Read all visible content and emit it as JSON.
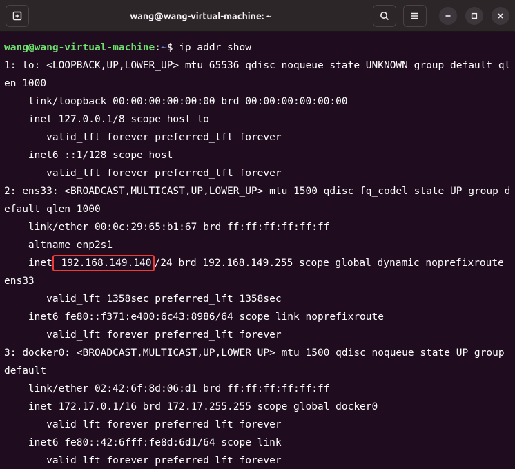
{
  "titlebar": {
    "title": "wang@wang-virtual-machine: ~"
  },
  "prompt": {
    "user_host": "wang@wang-virtual-machine",
    "colon": ":",
    "path": "~",
    "dollar": "$ "
  },
  "command": "ip addr show",
  "highlight": " 192.168.149.140",
  "output": {
    "l1": "1: lo: <LOOPBACK,UP,LOWER_UP> mtu 65536 qdisc noqueue state UNKNOWN group default qlen 1000",
    "l2": "    link/loopback 00:00:00:00:00:00 brd 00:00:00:00:00:00",
    "l3": "    inet 127.0.0.1/8 scope host lo",
    "l4": "       valid_lft forever preferred_lft forever",
    "l5": "    inet6 ::1/128 scope host",
    "l6": "       valid_lft forever preferred_lft forever",
    "l7": "2: ens33: <BROADCAST,MULTICAST,UP,LOWER_UP> mtu 1500 qdisc fq_codel state UP group default qlen 1000",
    "l8": "    link/ether 00:0c:29:65:b1:67 brd ff:ff:ff:ff:ff:ff",
    "l9": "    altname enp2s1",
    "l10a": "    inet",
    "l10b": "/24 brd 192.168.149.255 scope global dynamic noprefixroute ens33",
    "l11": "       valid_lft 1358sec preferred_lft 1358sec",
    "l12": "    inet6 fe80::f371:e400:6c43:8986/64 scope link noprefixroute",
    "l13": "       valid_lft forever preferred_lft forever",
    "l14": "3: docker0: <BROADCAST,MULTICAST,UP,LOWER_UP> mtu 1500 qdisc noqueue state UP group default",
    "l15": "    link/ether 02:42:6f:8d:06:d1 brd ff:ff:ff:ff:ff:ff",
    "l16": "    inet 172.17.0.1/16 brd 172.17.255.255 scope global docker0",
    "l17": "       valid_lft forever preferred_lft forever",
    "l18": "    inet6 fe80::42:6fff:fe8d:6d1/64 scope link",
    "l19": "       valid_lft forever preferred_lft forever"
  }
}
